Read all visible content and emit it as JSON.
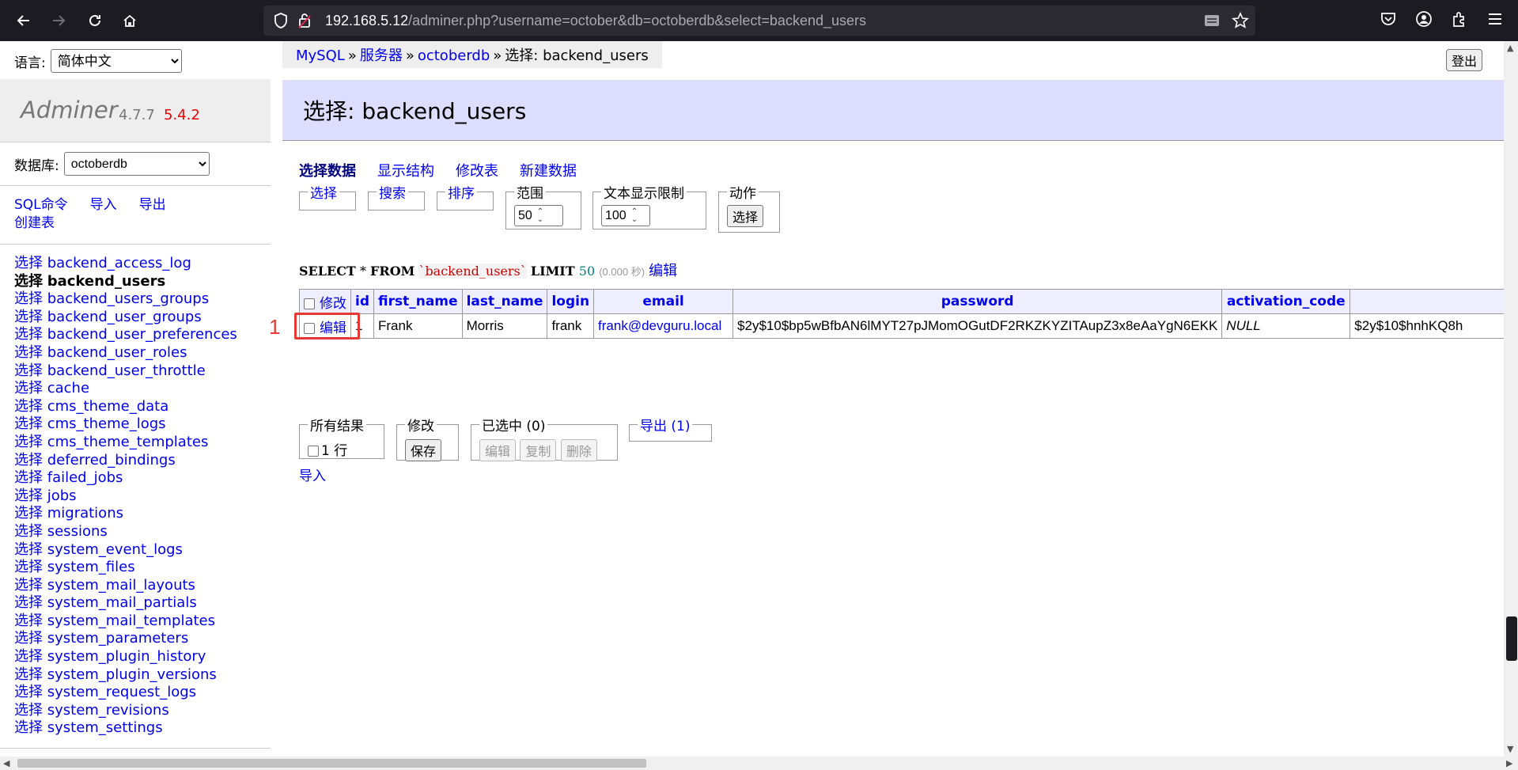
{
  "browser": {
    "url_host": "192.168.5.12",
    "url_path": "/adminer.php?username=october&db=octoberdb&select=backend_users",
    "colors": {
      "chrome": "#1c1b22",
      "urlbar": "#2b2a33"
    }
  },
  "menu": {
    "language_label": "语言:",
    "language_value": "简体中文",
    "brand_name": "Adminer",
    "brand_version": "4.7.7",
    "brand_new_version": "5.4.2",
    "database_label": "数据库:",
    "database_value": "octoberdb",
    "links": {
      "sql": "SQL命令",
      "import": "导入",
      "export": "导出",
      "create_table": "创建表"
    },
    "select_prefix": "选择",
    "tables": [
      "backend_access_log",
      "backend_users",
      "backend_users_groups",
      "backend_user_groups",
      "backend_user_preferences",
      "backend_user_roles",
      "backend_user_throttle",
      "cache",
      "cms_theme_data",
      "cms_theme_logs",
      "cms_theme_templates",
      "deferred_bindings",
      "failed_jobs",
      "jobs",
      "migrations",
      "sessions",
      "system_event_logs",
      "system_files",
      "system_mail_layouts",
      "system_mail_partials",
      "system_mail_templates",
      "system_parameters",
      "system_plugin_history",
      "system_plugin_versions",
      "system_request_logs",
      "system_revisions",
      "system_settings"
    ],
    "active_table": "backend_users"
  },
  "breadcrumb": {
    "mysql": "MySQL",
    "sep": "»",
    "server": "服务器",
    "db": "octoberdb",
    "current": "选择: backend_users"
  },
  "logout": "登出",
  "title": "选择: backend_users",
  "tabs": {
    "select_data": "选择数据",
    "show_structure": "显示结构",
    "alter_table": "修改表",
    "new_item": "新建数据"
  },
  "filters": {
    "select": "选择",
    "search": "搜索",
    "sort": "排序",
    "limit_label": "范围",
    "limit_value": "50",
    "text_length_label": "文本显示限制",
    "text_length_value": "100",
    "action_label": "动作",
    "action_button": "选择"
  },
  "sql": {
    "select_kw": "SELECT",
    "star": "*",
    "from_kw": "FROM",
    "table": "`backend_users`",
    "limit_kw": "LIMIT",
    "limit_num": "50",
    "time": "(0.000 秒)",
    "edit": "编辑"
  },
  "table": {
    "modify_header": "修改",
    "columns": [
      "id",
      "first_name",
      "last_name",
      "login",
      "email",
      "password",
      "activation_code",
      ""
    ],
    "rows": [
      {
        "edit": "编辑",
        "id": "1",
        "first_name": "Frank",
        "last_name": "Morris",
        "login": "frank",
        "email": "frank@devguru.local",
        "password": "$2y$10$bp5wBfbAN6lMYT27pJMomOGutDF2RKZKYZITAupZ3x8eAaYgN6EKK",
        "activation_code": "NULL",
        "extra": "$2y$10$hnhKQ8h"
      }
    ],
    "row_marker_label": "1",
    "marker_color": "#e53935"
  },
  "bottom": {
    "all_results_label": "所有结果",
    "all_results_value": "1 行",
    "modify_label": "修改",
    "save_button": "保存",
    "selected_label": "已选中 (0)",
    "edit_button": "编辑",
    "clone_button": "复制",
    "delete_button": "删除",
    "export_label": "导出 (1)",
    "import_link": "导入"
  }
}
